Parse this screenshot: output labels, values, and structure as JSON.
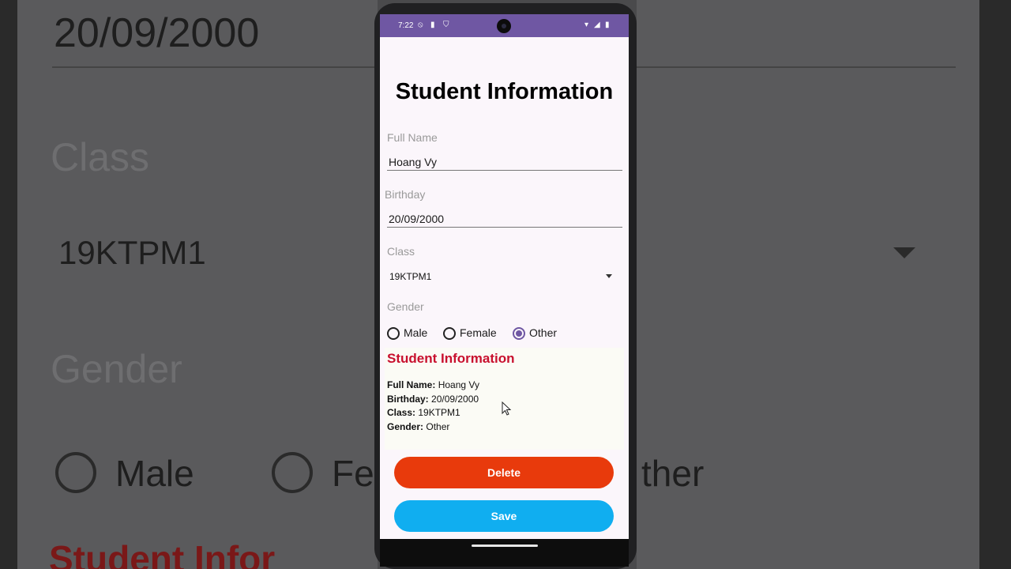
{
  "background": {
    "birthday_value": "20/09/2000",
    "class_label": "Class",
    "class_value": "19KTPM1",
    "gender_label": "Gender",
    "radio_male": "Male",
    "radio_female_partial": "Fe",
    "radio_other_partial": "ther",
    "info_title_partial": "Student Infor"
  },
  "status_bar": {
    "time": "7:22"
  },
  "form": {
    "title": "Student Information",
    "full_name_label": "Full Name",
    "full_name_value": "Hoang Vy",
    "birthday_label": "Birthday",
    "birthday_value": "20/09/2000",
    "class_label": "Class",
    "class_value": "19KTPM1",
    "gender_label": "Gender",
    "gender_options": [
      "Male",
      "Female",
      "Other"
    ],
    "gender_selected": "Other"
  },
  "info": {
    "title": "Student Information",
    "full_name_key": "Full Name:",
    "full_name_val": "Hoang Vy",
    "birthday_key": "Birthday:",
    "birthday_val": "20/09/2000",
    "class_key": "Class:",
    "class_val": "19KTPM1",
    "gender_key": "Gender:",
    "gender_val": "Other"
  },
  "buttons": {
    "delete_label": "Delete",
    "save_label": "Save"
  },
  "colors": {
    "accent": "#6f57a3",
    "delete": "#e83a0c",
    "save": "#10aef0",
    "info_title": "#c8102e"
  }
}
